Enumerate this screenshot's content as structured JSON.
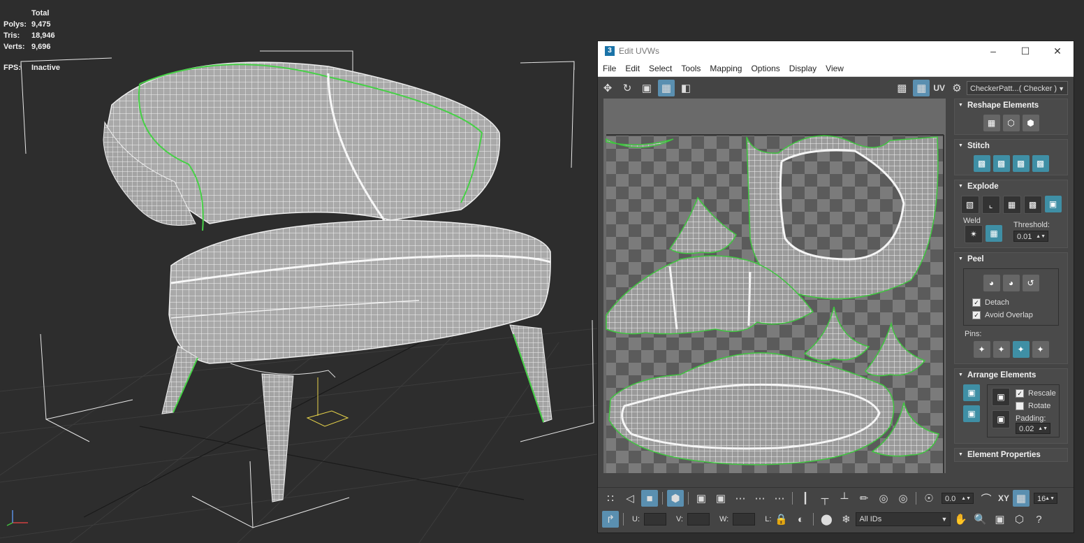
{
  "stats": {
    "header": "Total",
    "rows": [
      {
        "label": "Polys:",
        "value": "9,475"
      },
      {
        "label": "Tris:",
        "value": "18,946"
      },
      {
        "label": "Verts:",
        "value": "9,696"
      }
    ],
    "fps_label": "FPS:",
    "fps_value": "Inactive"
  },
  "uvw_window": {
    "title": "Edit UVWs",
    "app_icon": "3",
    "menu": [
      "File",
      "Edit",
      "Select",
      "Tools",
      "Mapping",
      "Options",
      "Display",
      "View"
    ],
    "uv_label": "UV",
    "texture_dropdown": "CheckerPatt...( Checker )",
    "colors": {
      "accent": "#3f8fa5",
      "seam": "#3fc53f",
      "checker_dark": "#5b5b5b",
      "checker_light": "#7b7b7b"
    }
  },
  "panel": {
    "reshape": {
      "title": "Reshape Elements"
    },
    "stitch": {
      "title": "Stitch"
    },
    "explode": {
      "title": "Explode",
      "weld_label": "Weld",
      "threshold_label": "Threshold:",
      "threshold_value": "0.01"
    },
    "peel": {
      "title": "Peel",
      "detach_label": "Detach",
      "detach_checked": true,
      "avoid_label": "Avoid Overlap",
      "avoid_checked": true,
      "pins_label": "Pins:"
    },
    "arrange": {
      "title": "Arrange Elements",
      "rescale_label": "Rescale",
      "rescale_checked": true,
      "rotate_label": "Rotate",
      "rotate_checked": false,
      "padding_label": "Padding:",
      "padding_value": "0.02"
    },
    "element_props": {
      "title": "Element Properties"
    }
  },
  "bottom": {
    "spinner_value": "0.0",
    "xy_label": "XY",
    "grid_value": "16",
    "u_label": "U:",
    "v_label": "V:",
    "w_label": "W:",
    "l_label": "L:",
    "ids_select": "All IDs"
  }
}
